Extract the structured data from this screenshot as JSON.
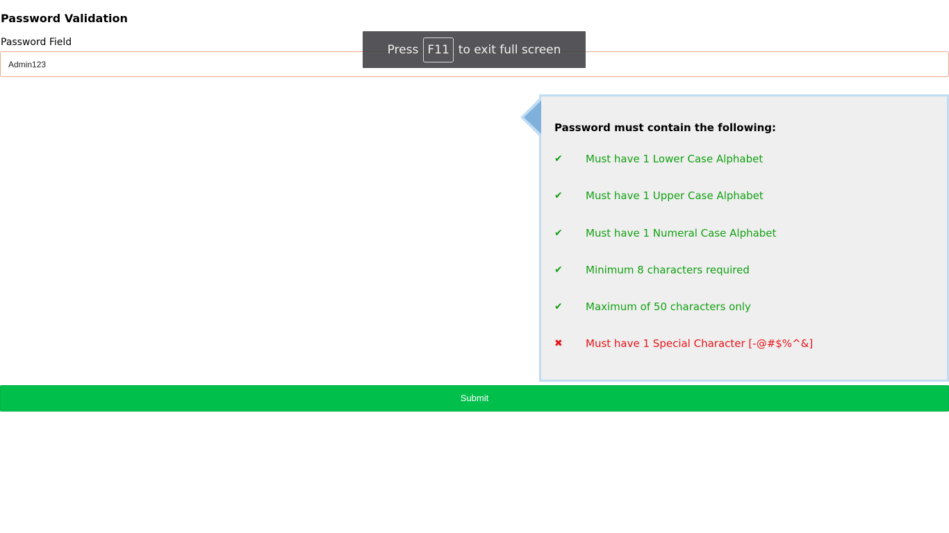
{
  "page": {
    "title": "Password Validation"
  },
  "form": {
    "field_label": "Password Field",
    "password_value": "Admin123",
    "submit_label": "Submit"
  },
  "fullscreen_notice": {
    "before": "Press",
    "key": "F11",
    "after": "to exit full screen"
  },
  "validation": {
    "heading": "Password must contain the following:",
    "rules": [
      {
        "icon": "✔",
        "icon_name": "check-icon",
        "text": "Must have 1 Lower Case Alphabet",
        "status": "valid"
      },
      {
        "icon": "✔",
        "icon_name": "check-icon",
        "text": "Must have 1 Upper Case Alphabet",
        "status": "valid"
      },
      {
        "icon": "✔",
        "icon_name": "check-icon",
        "text": "Must have 1 Numeral Case Alphabet",
        "status": "valid"
      },
      {
        "icon": "✔",
        "icon_name": "check-icon",
        "text": "Minimum 8 characters required",
        "status": "valid"
      },
      {
        "icon": "✔",
        "icon_name": "check-icon",
        "text": "Maximum of 50 characters only",
        "status": "valid"
      },
      {
        "icon": "✖",
        "icon_name": "cross-icon",
        "text": "Must have 1 Special Character [-@#$%^&]",
        "status": "invalid"
      }
    ]
  },
  "colors": {
    "valid": "#12a012",
    "invalid": "#e8141a",
    "submit_bg": "#00c04b",
    "panel_border": "#c1dcf2",
    "panel_bg": "#efefef",
    "input_border": "#f0a58a"
  }
}
